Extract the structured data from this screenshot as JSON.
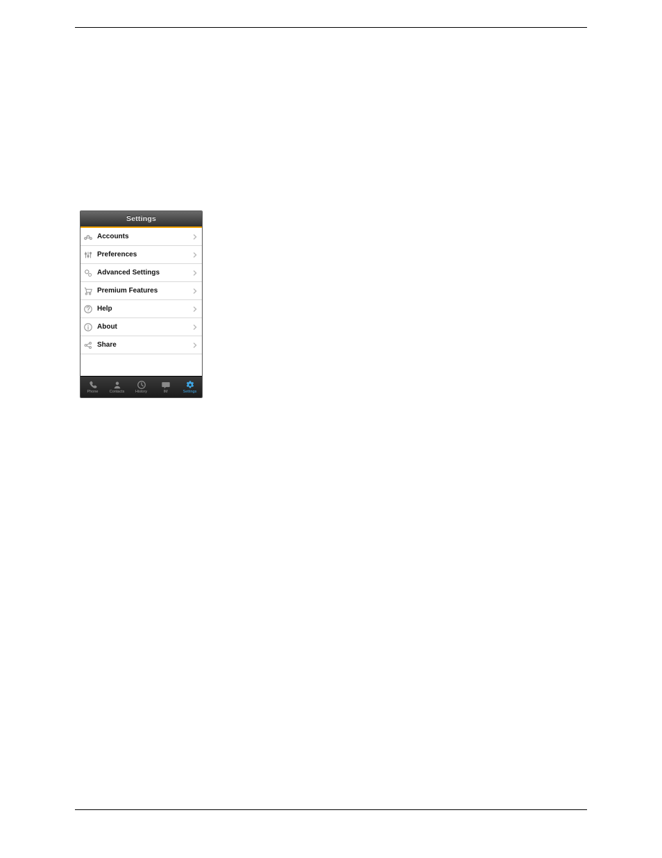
{
  "header": {
    "title": "Settings"
  },
  "menu": {
    "items": [
      {
        "icon": "accounts-icon",
        "label": "Accounts"
      },
      {
        "icon": "preferences-icon",
        "label": "Preferences"
      },
      {
        "icon": "advanced-settings-icon",
        "label": "Advanced Settings"
      },
      {
        "icon": "premium-features-icon",
        "label": "Premium Features"
      },
      {
        "icon": "help-icon",
        "label": "Help"
      },
      {
        "icon": "about-icon",
        "label": "About"
      },
      {
        "icon": "share-icon",
        "label": "Share"
      }
    ]
  },
  "tabbar": {
    "items": [
      {
        "icon": "phone-icon",
        "label": "Phone",
        "active": false
      },
      {
        "icon": "contacts-icon",
        "label": "Contacts",
        "active": false
      },
      {
        "icon": "history-icon",
        "label": "History",
        "active": false
      },
      {
        "icon": "im-icon",
        "label": "IM",
        "active": false
      },
      {
        "icon": "settings-icon",
        "label": "Settings",
        "active": true
      }
    ]
  }
}
